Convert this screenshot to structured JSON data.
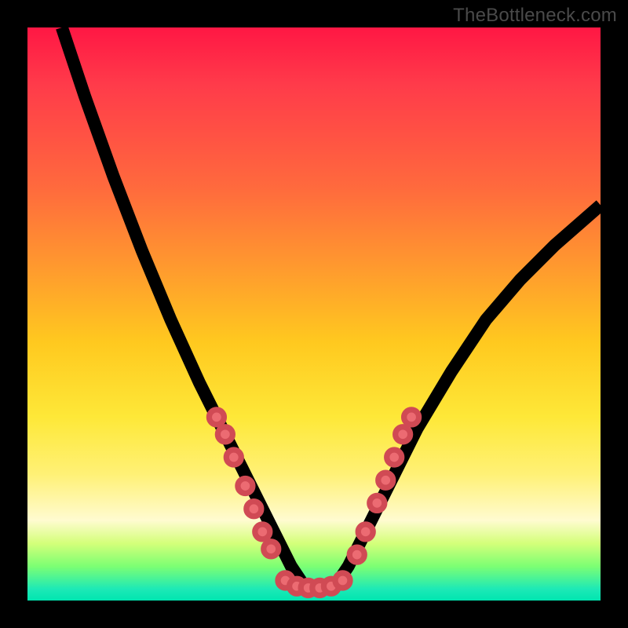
{
  "watermark": "TheBottleneck.com",
  "chart_data": {
    "type": "line",
    "title": "",
    "xlabel": "",
    "ylabel": "",
    "xlim": [
      0,
      100
    ],
    "ylim": [
      0,
      100
    ],
    "series": [
      {
        "name": "curve",
        "x": [
          6,
          10,
          15,
          20,
          25,
          30,
          33,
          36,
          39,
          42,
          44,
          46,
          48,
          50,
          52,
          54,
          56,
          59,
          63,
          68,
          74,
          80,
          86,
          92,
          100
        ],
        "y": [
          100,
          88,
          74,
          61,
          49,
          38,
          32,
          26,
          20,
          14,
          10,
          6,
          3,
          2,
          2,
          3,
          6,
          12,
          20,
          30,
          40,
          49,
          56,
          62,
          69
        ]
      }
    ],
    "dots": {
      "_comment": "salmon dots along the lower part of the curve",
      "left": [
        [
          33,
          32
        ],
        [
          34.5,
          29
        ],
        [
          36,
          25
        ],
        [
          38,
          20
        ],
        [
          39.5,
          16
        ],
        [
          41,
          12
        ],
        [
          42.5,
          9
        ]
      ],
      "floor": [
        [
          45,
          3.5
        ],
        [
          47,
          2.5
        ],
        [
          49,
          2.2
        ],
        [
          51,
          2.2
        ],
        [
          53,
          2.5
        ],
        [
          55,
          3.5
        ]
      ],
      "right": [
        [
          57.5,
          8
        ],
        [
          59,
          12
        ],
        [
          61,
          17
        ],
        [
          62.5,
          21
        ],
        [
          64,
          25
        ],
        [
          65.5,
          29
        ],
        [
          67,
          32
        ]
      ]
    },
    "colors": {
      "dot_fill": "#ec6b72",
      "dot_stroke": "#d04a54",
      "curve": "#000000"
    }
  }
}
